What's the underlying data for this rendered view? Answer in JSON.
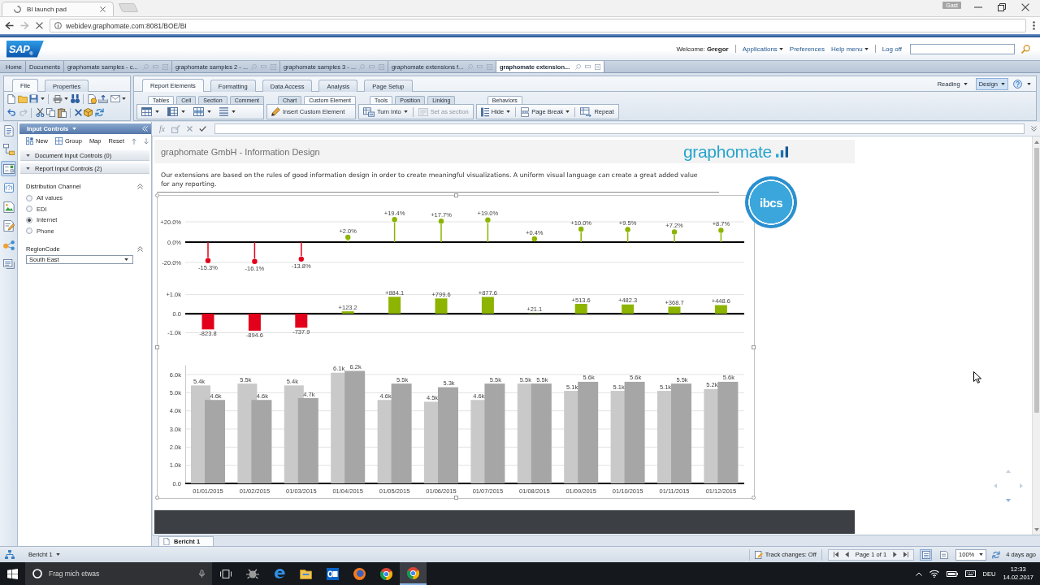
{
  "browser": {
    "tabs": [
      {
        "title": "BI launch pad",
        "selected": true
      }
    ],
    "profile": "Gast",
    "url": "webidev.graphomate.com:8081/BOE/BI"
  },
  "portal": {
    "logo": "SAP$_{®}$",
    "welcome": "Welcome: **Gregor**",
    "links": [
      {
        "label": "Applications",
        "menu": true
      },
      {
        "label": "Preferences",
        "menu": false
      },
      {
        "label": "Help menu",
        "menu": true
      },
      {
        "label": "Log off",
        "menu": false
      }
    ],
    "document_tabs": [
      {
        "kind": "page",
        "label": "Home",
        "selected": false
      },
      {
        "kind": "page",
        "label": "Documents",
        "selected": false
      },
      {
        "kind": "document",
        "label": "graphomate samples - c...",
        "selected": false
      },
      {
        "kind": "document",
        "label": "graphomate samples 2 - ...",
        "selected": false
      },
      {
        "kind": "document",
        "label": "graphomate samples 3 - ...",
        "selected": false
      },
      {
        "kind": "document",
        "label": "graphomate extensions f...",
        "selected": false
      },
      {
        "kind": "document",
        "label": "graphomate extension...",
        "selected": true
      }
    ]
  },
  "ribbon": {
    "side_tabs": [
      {
        "label": "File",
        "selected": true
      },
      {
        "label": "Properties",
        "selected": false
      }
    ],
    "tabs": [
      {
        "label": "Report Elements",
        "selected": true
      },
      {
        "label": "Formatting",
        "selected": false
      },
      {
        "label": "Data Access",
        "selected": false
      },
      {
        "label": "Analysis",
        "selected": false
      },
      {
        "label": "Page Setup",
        "selected": false
      }
    ],
    "groups": [
      {
        "kind": "icons",
        "tabs": [
          {
            "label": "Tables",
            "selected": true
          },
          {
            "label": "Cell",
            "selected": false
          },
          {
            "label": "Section",
            "selected": false
          },
          {
            "label": "Comment",
            "selected": false
          }
        ]
      },
      {
        "kind": "buttons",
        "tabs": [
          {
            "label": "Chart",
            "selected": false
          },
          {
            "label": "Custom Element",
            "selected": true
          }
        ],
        "commands": [
          {
            "label": "Insert Custom Element",
            "menu": false,
            "disabled": false
          }
        ]
      },
      {
        "kind": "buttons",
        "tabs": [
          {
            "label": "Tools",
            "selected": true
          },
          {
            "label": "Position",
            "selected": false
          },
          {
            "label": "Linking",
            "selected": false
          }
        ],
        "commands": [
          {
            "label": "Turn Into",
            "menu": true,
            "disabled": false
          },
          {
            "label": "Set as section",
            "menu": false,
            "disabled": true
          }
        ]
      },
      {
        "kind": "buttons",
        "tabs": [
          {
            "label": "Behaviors",
            "selected": true
          }
        ],
        "commands": [
          {
            "label": "Hide",
            "menu": true,
            "disabled": false
          },
          {
            "label": "Page Break",
            "menu": true,
            "disabled": false
          },
          {
            "label": "Repeat",
            "menu": false,
            "disabled": false
          }
        ]
      }
    ],
    "modes": [
      {
        "label": "Reading",
        "selected": false
      },
      {
        "label": "Design",
        "selected": true
      }
    ]
  },
  "formula_bar": {
    "symbol": "fx"
  },
  "side_rail": [
    {
      "selected": false
    },
    {
      "selected": false
    },
    {
      "selected": true
    },
    {
      "selected": false
    },
    {
      "selected": false
    },
    {
      "selected": false
    },
    {
      "selected": false
    },
    {
      "selected": false
    }
  ],
  "input_controls": {
    "title": "Input Controls",
    "actions": [
      {
        "label": "New",
        "kind": "iconed"
      },
      {
        "label": "Group",
        "kind": "iconed"
      },
      {
        "label": "Map",
        "kind": "plain"
      },
      {
        "label": "Reset",
        "kind": "plain"
      }
    ],
    "sections": [
      {
        "label": "Document Input Controls (0)",
        "expanded": true
      },
      {
        "label": "Report Input Controls (2)",
        "expanded": true
      }
    ],
    "controls": [
      {
        "kind": "radio",
        "label": "Distribution Channel",
        "expanded": true,
        "options": [
          {
            "label": "All values",
            "selected": false
          },
          {
            "label": "EDI",
            "selected": false
          },
          {
            "label": "Internet",
            "selected": true
          },
          {
            "label": "Phone",
            "selected": false
          }
        ]
      },
      {
        "kind": "dropdown",
        "label": "RegionCode",
        "expanded": true,
        "value": "South East"
      }
    ]
  },
  "report": {
    "title": "graphomate GmbH - Information Design",
    "logo": "graphomate",
    "intro": "Our extensions are based on the rules of good information design in order to create meaningful visualizations. A uniform visual language can create a great added value for any reporting.",
    "badge": "ibcs",
    "charts": [
      {
        "kind": "pin",
        "chart_data": {
          "type": "bar",
          "grid": true,
          "ylim": [
            -20,
            20
          ],
          "yticks": [
            {
              "value": 20,
              "label": "+20.0%"
            },
            {
              "value": 0,
              "label": "0.0%"
            },
            {
              "value": -20,
              "label": "-20.0%"
            }
          ],
          "values": [
            -15.3,
            -16.1,
            -13.8,
            2.0,
            19.4,
            17.7,
            19.0,
            0.4,
            10.0,
            9.5,
            7.2,
            8.7
          ],
          "value_labels": [
            "-15.3%",
            "-16.1%",
            "-13.8%",
            "+2.0%",
            "+19.4%",
            "+17.7%",
            "+19.0%",
            "+0.4%",
            "+10.0%",
            "+9.5%",
            "+7.2%",
            "+8.7%"
          ]
        }
      },
      {
        "kind": "bar",
        "chart_data": {
          "type": "bar",
          "grid": true,
          "ylim": [
            -1000,
            1000
          ],
          "yticks": [
            {
              "value": 1000,
              "label": "+1.0k"
            },
            {
              "value": 0,
              "label": "0.0"
            },
            {
              "value": -1000,
              "label": "-1.0k"
            }
          ],
          "values": [
            -823.8,
            -894.6,
            -737.9,
            123.2,
            884.1,
            799.6,
            877.6,
            21.1,
            513.6,
            482.3,
            368.7,
            448.6
          ],
          "value_labels": [
            "-823.8",
            "-894.6",
            "-737.9",
            "+123.2",
            "+884.1",
            "+799.6",
            "+877.6",
            "+21.1",
            "+513.6",
            "+482.3",
            "+368.7",
            "+448.6"
          ]
        }
      },
      {
        "kind": "grouped",
        "chart_data": {
          "type": "bar",
          "grid": true,
          "ylim": [
            0,
            6500
          ],
          "yticks": [
            {
              "value": 0,
              "label": "0.0"
            },
            {
              "value": 1000,
              "label": "1.0k"
            },
            {
              "value": 2000,
              "label": "2.0k"
            },
            {
              "value": 3000,
              "label": "3.0k"
            },
            {
              "value": 4000,
              "label": "4.0k"
            },
            {
              "value": 5000,
              "label": "5.0k"
            },
            {
              "value": 6000,
              "label": "6.0k"
            }
          ],
          "categories": [
            "01/01/2015",
            "01/02/2015",
            "01/03/2015",
            "01/04/2015",
            "01/05/2015",
            "01/06/2015",
            "01/07/2015",
            "01/08/2015",
            "01/09/2015",
            "01/10/2015",
            "01/11/2015",
            "01/12/2015"
          ],
          "series": [
            {
              "color": "#c9c9c9",
              "values": [
                5400,
                5500,
                5400,
                6100,
                4600,
                4500,
                4600,
                5500,
                5100,
                5100,
                5100,
                5200
              ],
              "value_labels": [
                "5.4k",
                "5.5k",
                "5.4k",
                "6.1k",
                "4.6k",
                "4.5k",
                "4.6k",
                "5.5k",
                "5.1k",
                "5.1k",
                "5.1k",
                "5.2k"
              ]
            },
            {
              "color": "#a6a6a6",
              "values": [
                4600,
                4600,
                4700,
                6200,
                5500,
                5300,
                5500,
                5500,
                5600,
                5600,
                5500,
                5600
              ],
              "value_labels": [
                "4.6k",
                "4.6k",
                "4.7k",
                "6.2k",
                "5.5k",
                "5.3k",
                "5.5k",
                "5.5k",
                "5.6k",
                "5.6k",
                "5.5k",
                "5.6k"
              ]
            }
          ]
        }
      }
    ],
    "sheet_tabs": [
      {
        "label": "Bericht 1",
        "selected": true
      }
    ]
  },
  "status_bar": {
    "report": "Bericht 1",
    "track_changes": "Track changes: Off",
    "page": "Page 1 of 1",
    "views": [
      {
        "selected": true
      },
      {
        "selected": false
      }
    ],
    "zoom": "100%",
    "refreshed": "4 days ago"
  },
  "taskbar": {
    "search_placeholder": "Frag mich etwas",
    "apps": [
      {
        "selected": false
      },
      {
        "selected": false
      },
      {
        "selected": false
      },
      {
        "selected": false
      },
      {
        "selected": false
      },
      {
        "selected": false
      },
      {
        "selected": false
      },
      {
        "selected": true
      }
    ],
    "language": "DEU",
    "time": "12:33",
    "date": "14.02.2017"
  }
}
